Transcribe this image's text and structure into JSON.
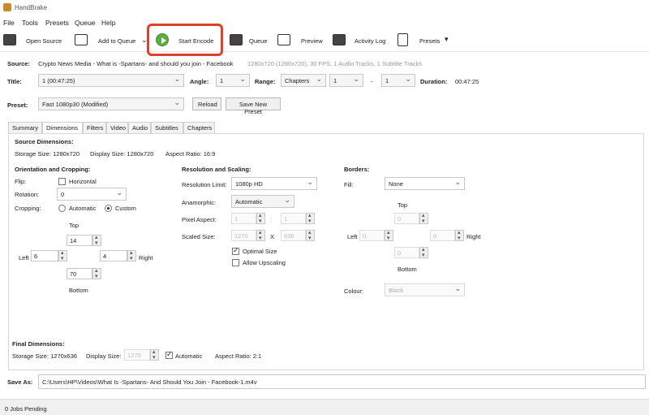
{
  "app": {
    "title": "HandBrake"
  },
  "menu": [
    "File",
    "Tools",
    "Presets",
    "Queue",
    "Help"
  ],
  "toolbar": {
    "open_source": "Open Source",
    "add_to_queue": "Add to Queue",
    "start_encode": "Start Encode",
    "queue": "Queue",
    "preview": "Preview",
    "activity_log": "Activity Log",
    "presets": "Presets"
  },
  "source": {
    "label": "Source:",
    "name": "Crypto News Media - What is -Spartans- and should you join - Facebook",
    "info": "1280x720 (1280x720), 30 FPS, 1 Audio Tracks, 1 Subtitle Tracks"
  },
  "title_row": {
    "title_label": "Title:",
    "title_value": "1  (00:47:25)",
    "angle_label": "Angle:",
    "angle_value": "1",
    "range_label": "Range:",
    "range_type": "Chapters",
    "range_from": "1",
    "range_sep": "-",
    "range_to": "1",
    "duration_label": "Duration:",
    "duration_value": "00:47:25"
  },
  "preset_row": {
    "label": "Preset:",
    "value": "Fast 1080p30  (Modified)",
    "reload": "Reload",
    "save_new": "Save New Preset"
  },
  "tabs": [
    "Summary",
    "Dimensions",
    "Filters",
    "Video",
    "Audio",
    "Subtitles",
    "Chapters"
  ],
  "dimensions": {
    "source_title": "Source Dimensions:",
    "storage_size": "Storage Size: 1280x720",
    "display_size": "Display Size: 1280x720",
    "aspect_ratio": "Aspect Ratio: 16:9",
    "orientation_title": "Orientation and Cropping:",
    "flip_label": "Flip:",
    "flip_option": "Horizontal",
    "rotation_label": "Rotation:",
    "rotation_value": "0",
    "cropping_label": "Cropping:",
    "crop_automatic": "Automatic",
    "crop_custom": "Custom",
    "top_label": "Top",
    "crop_top": "14",
    "left_label": "Left",
    "crop_left": "6",
    "crop_right": "4",
    "right_label": "Right",
    "crop_bottom": "70",
    "bottom_label": "Bottom",
    "resolution_title": "Resolution and Scaling:",
    "res_limit_label": "Resolution Limit:",
    "res_limit_value": "1080p HD",
    "anamorphic_label": "Anamorphic:",
    "anamorphic_value": "Automatic",
    "pixel_aspect_label": "Pixel Aspect:",
    "pixel_aspect_a": "1",
    "pixel_aspect_sep": ":",
    "pixel_aspect_b": "1",
    "scaled_size_label": "Scaled Size:",
    "scaled_w": "1270",
    "scaled_x": "X",
    "scaled_h": "636",
    "optimal_size": "Optimal Size",
    "allow_upscaling": "Allow Upscaling",
    "borders_title": "Borders:",
    "fill_label": "Fill:",
    "fill_value": "None",
    "b_top_label": "Top",
    "b_top": "0",
    "b_left_label": "Left",
    "b_left": "0",
    "b_right": "0",
    "b_right_label": "Right",
    "b_bottom": "0",
    "b_bottom_label": "Bottom",
    "colour_label": "Colour:",
    "colour_value": "Black",
    "final_title": "Final Dimensions:",
    "final_storage": "Storage Size: 1270x636",
    "final_display_label": "Display Size:",
    "final_display_value": "1270",
    "final_automatic": "Automatic",
    "final_aspect": "Aspect Ratio: 2:1"
  },
  "save_as": {
    "label": "Save As:",
    "path": "C:\\Users\\HP\\Videos\\What Is -Spartans- And Should You Join - Facebook-1.m4v"
  },
  "status": {
    "text": "0 Jobs Pending"
  },
  "colors": {
    "highlight": "#e0402a",
    "encode_green": "#5cae3e"
  }
}
